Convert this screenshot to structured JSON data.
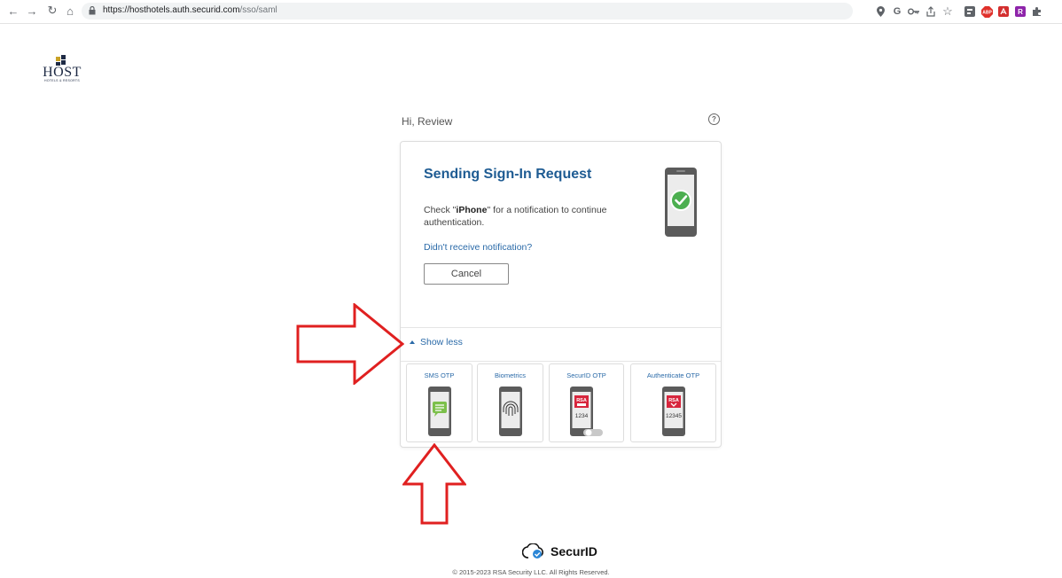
{
  "browser": {
    "url_host": "https://hosthotels.auth.securid.com",
    "url_path": "/sso/saml",
    "nav_icons": [
      "back-icon",
      "forward-icon",
      "reload-icon",
      "home-icon"
    ],
    "toolbar_icons": [
      "location-icon",
      "google-icon",
      "password-key-icon",
      "share-icon",
      "bookmark-star-icon",
      "extension-icon",
      "adblock-icon",
      "pdf-icon",
      "extension-icon",
      "puzzle-icon"
    ]
  },
  "brand": {
    "logo_word": "HOST",
    "logo_sub": "HOTELS & RESORTS"
  },
  "greeting": "Hi, Review",
  "card": {
    "title": "Sending Sign-In Request",
    "message_pre": "Check \"",
    "device": "iPhone",
    "message_post": "\" for a notification to continue authentication.",
    "help_link": "Didn't receive notification?",
    "cancel_label": "Cancel",
    "show_less_label": "Show less"
  },
  "methods": [
    {
      "label": "SMS OTP",
      "icon": "sms-phone-icon"
    },
    {
      "label": "Biometrics",
      "icon": "fingerprint-phone-icon"
    },
    {
      "label": "SecurID OTP",
      "icon": "securid-otp-phone-icon",
      "code": "1234",
      "tag": "RSA"
    },
    {
      "label": "Authenticate OTP",
      "icon": "authenticate-otp-phone-icon",
      "code": "12345",
      "tag": "RSA"
    }
  ],
  "footer": {
    "brand": "SecurID",
    "copyright": "© 2015-2023 RSA Security LLC. All Rights Reserved."
  },
  "colors": {
    "accent_blue": "#1f5c93",
    "link_blue": "#2a6aa8",
    "success_green": "#4caf50",
    "sms_green": "#7cc04b",
    "rsa_red": "#d7263d",
    "annotation_red": "#e02020"
  }
}
